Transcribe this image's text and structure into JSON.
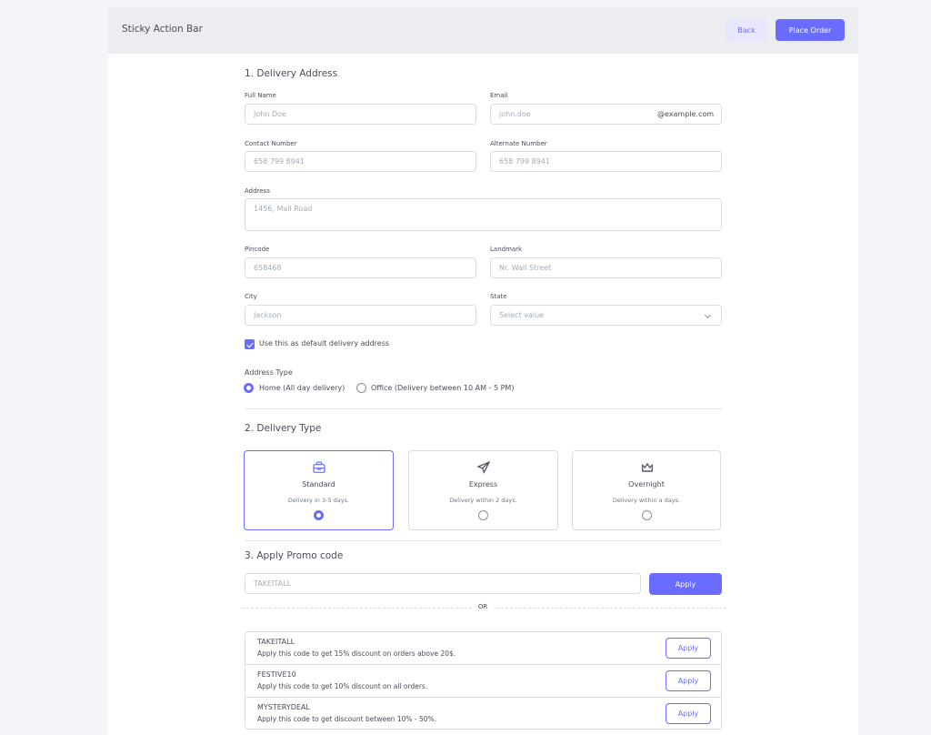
{
  "header": {
    "title": "Sticky Action Bar",
    "back_label": "Back",
    "place_order_label": "Place Order"
  },
  "delivery_address": {
    "heading": "1. Delivery Address",
    "full_name": {
      "label": "Full Name",
      "placeholder": "John Doe"
    },
    "email": {
      "label": "Email",
      "placeholder": "john.doe",
      "suffix": "@example.com"
    },
    "contact_number": {
      "label": "Contact Number",
      "placeholder": "658 799 8941"
    },
    "alternate_number": {
      "label": "Alternate Number",
      "placeholder": "658 799 8941"
    },
    "address": {
      "label": "Address",
      "placeholder": "1456, Mall Road"
    },
    "pincode": {
      "label": "Pincode",
      "placeholder": "658468"
    },
    "landmark": {
      "label": "Landmark",
      "placeholder": "Nr. Wall Street"
    },
    "city": {
      "label": "City",
      "placeholder": "Jackson"
    },
    "state": {
      "label": "State",
      "value": "Select value"
    },
    "default_checkbox": {
      "label": "Use this as default delivery address",
      "checked": true
    },
    "address_type": {
      "label": "Address Type",
      "options": [
        {
          "label": "Home (All day delivery)",
          "selected": true
        },
        {
          "label": "Office (Delivery between 10 AM - 5 PM)",
          "selected": false
        }
      ]
    }
  },
  "delivery_type": {
    "heading": "2. Delivery Type",
    "options": [
      {
        "title": "Standard",
        "desc": "Delivery in 3-5 days.",
        "icon": "briefcase-icon",
        "selected": true
      },
      {
        "title": "Express",
        "desc": "Delivery within 2 days.",
        "icon": "send-icon",
        "selected": false
      },
      {
        "title": "Overnight",
        "desc": "Delivery within a days.",
        "icon": "crown-icon",
        "selected": false
      }
    ]
  },
  "promo": {
    "heading": "3. Apply Promo code",
    "placeholder": "TAKEITALL",
    "apply_label": "Apply",
    "or_label": "OR",
    "codes": [
      {
        "code": "TAKEITALL",
        "desc": "Apply this code to get 15% discount on orders above 20$.",
        "button": "Apply"
      },
      {
        "code": "FESTIVE10",
        "desc": "Apply this code to get 10% discount on all orders.",
        "button": "Apply"
      },
      {
        "code": "MYSTERYDEAL",
        "desc": "Apply this code to get discount between 10% - 50%.",
        "button": "Apply"
      }
    ]
  },
  "colors": {
    "primary": "#696cff",
    "primary_light": "#e7e7ff",
    "bar_bg": "#ebedf0",
    "page_bg": "#f5f5f9"
  }
}
